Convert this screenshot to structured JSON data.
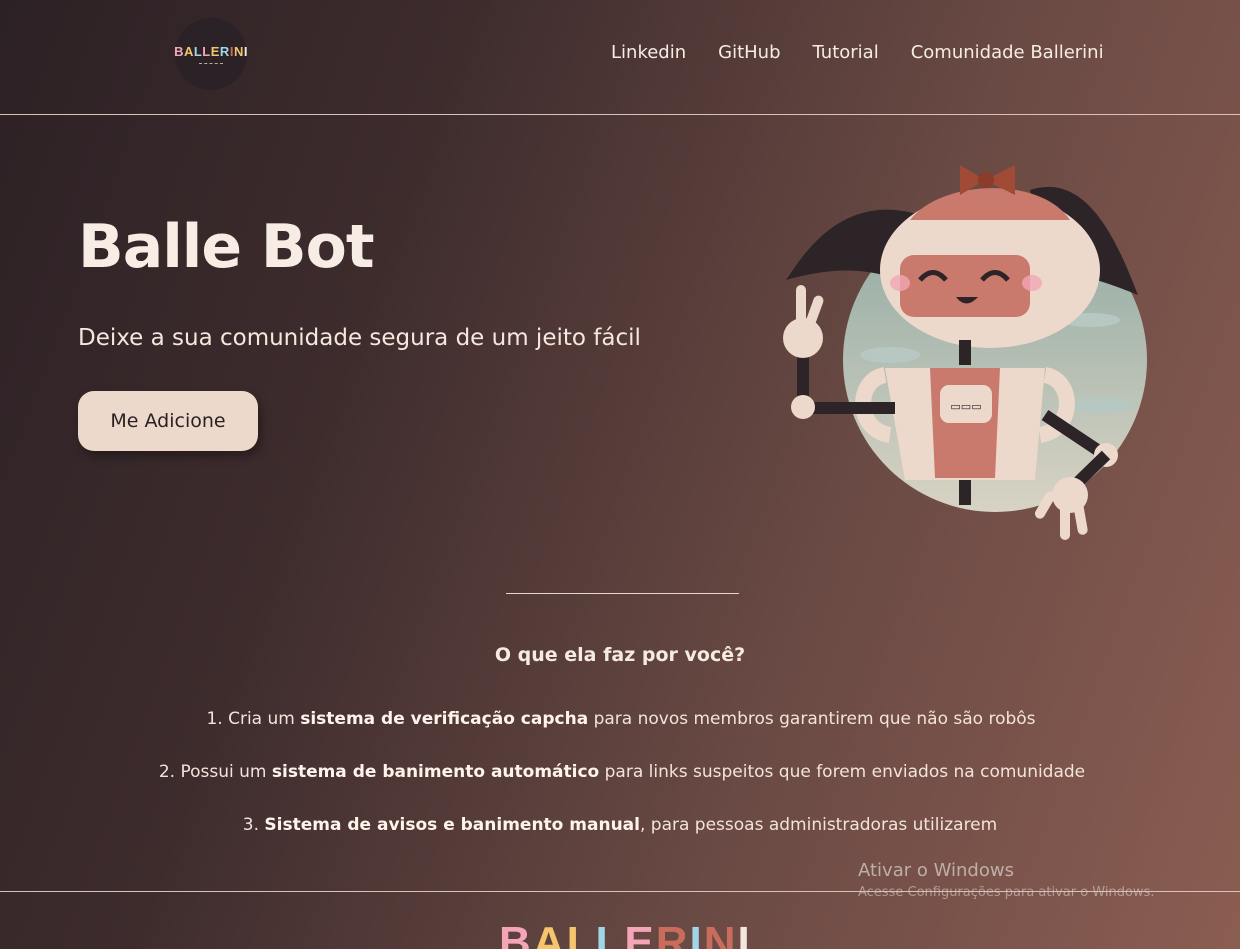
{
  "header": {
    "logo_text": "BALLERINI",
    "nav": [
      "Linkedin",
      "GitHub",
      "Tutorial",
      "Comunidade Ballerini"
    ]
  },
  "hero": {
    "title": "Balle Bot",
    "subtitle": "Deixe a sua comunidade segura de um jeito fácil",
    "cta_label": "Me Adicione"
  },
  "features_section": {
    "title": "O que ela faz por você?",
    "items": [
      {
        "prefix": "1. Cria um ",
        "bold": "sistema de verificação capcha",
        "suffix": " para novos membros garantirem que não são robôs"
      },
      {
        "prefix": "2. Possui um ",
        "bold": "sistema de banimento automático",
        "suffix": " para links suspeitos que forem enviados na comunidade"
      },
      {
        "prefix": "3. ",
        "bold": "Sistema de avisos e banimento manual",
        "suffix": ", para pessoas administradoras utilizarem"
      }
    ]
  },
  "watermark": {
    "title": "Ativar o Windows",
    "subtitle": "Acesse Configurações para ativar o Windows."
  },
  "footer": {
    "logo_text": "BALLERINI"
  },
  "colors": {
    "button_bg": "#ecd9cc",
    "robot_face": "#ecd9cc",
    "robot_accent": "#c97a6c"
  }
}
